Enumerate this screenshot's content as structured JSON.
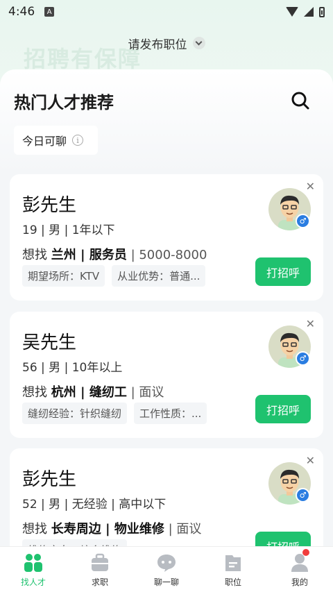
{
  "status_bar": {
    "time": "4:46",
    "notification_icon": "A"
  },
  "header": {
    "job_selector_label": "请发布职位",
    "banner_text": "招聘有保障"
  },
  "section": {
    "title": "热门人才推荐",
    "filter_label": "今日可聊"
  },
  "candidates": [
    {
      "name": "彭先生",
      "meta": "19 | 男 | 1年以下",
      "want_prefix": "想找 ",
      "want_job": "兰州 | 服务员",
      "salary": " | 5000-8000",
      "tags": [
        "期望场所：KTV",
        "从业优势：普通..."
      ],
      "gender_symbol": "♂",
      "call_label": "打招呼"
    },
    {
      "name": "吴先生",
      "meta": "56 | 男 | 10年以上",
      "want_prefix": "想找 ",
      "want_job": "杭州 | 缝纫工",
      "salary": " | 面议",
      "tags": [
        "缝纫经验：针织缝纫",
        "工作性质：..."
      ],
      "gender_symbol": "♂",
      "call_label": "打招呼"
    },
    {
      "name": "彭先生",
      "meta": "52 | 男 | 无经验 | 高中以下",
      "want_prefix": "想找 ",
      "want_job": "长寿周边 | 物业维修",
      "salary": " | 面议",
      "tags": [
        "维修方向：综合维修"
      ],
      "gender_symbol": "♂",
      "call_label": "打招呼"
    }
  ],
  "tabbar": {
    "items": [
      {
        "label": "找人才",
        "icon": "find-talent-icon"
      },
      {
        "label": "求职",
        "icon": "briefcase-icon"
      },
      {
        "label": "聊一聊",
        "icon": "chat-icon"
      },
      {
        "label": "职位",
        "icon": "position-icon"
      },
      {
        "label": "我的",
        "icon": "profile-icon"
      }
    ]
  },
  "colors": {
    "accent": "#1fc26f",
    "gender_badge": "#2a7de1",
    "badge_dot": "#f03c3c"
  }
}
